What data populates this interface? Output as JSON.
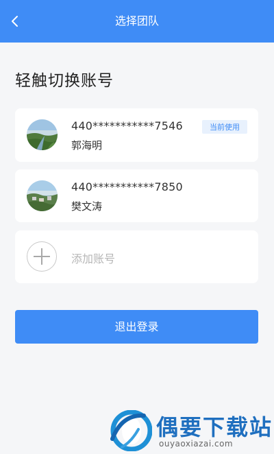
{
  "header": {
    "title": "选择团队",
    "back_icon": "chevron-left-icon"
  },
  "section_title": "轻触切换账号",
  "accounts": [
    {
      "number": "440***********7546",
      "name": "郭海明",
      "badge": "当前使用"
    },
    {
      "number": "440***********7850",
      "name": "樊文涛"
    }
  ],
  "add_account": {
    "label": "添加账号",
    "icon": "plus-circle-icon"
  },
  "logout_label": "退出登录",
  "watermark": {
    "title": "偶要下载站",
    "url": "ouyaoxiazai.com"
  },
  "colors": {
    "primary": "#3f8cf6",
    "background": "#f5f6f8",
    "badge_bg": "#e8f1fd"
  }
}
